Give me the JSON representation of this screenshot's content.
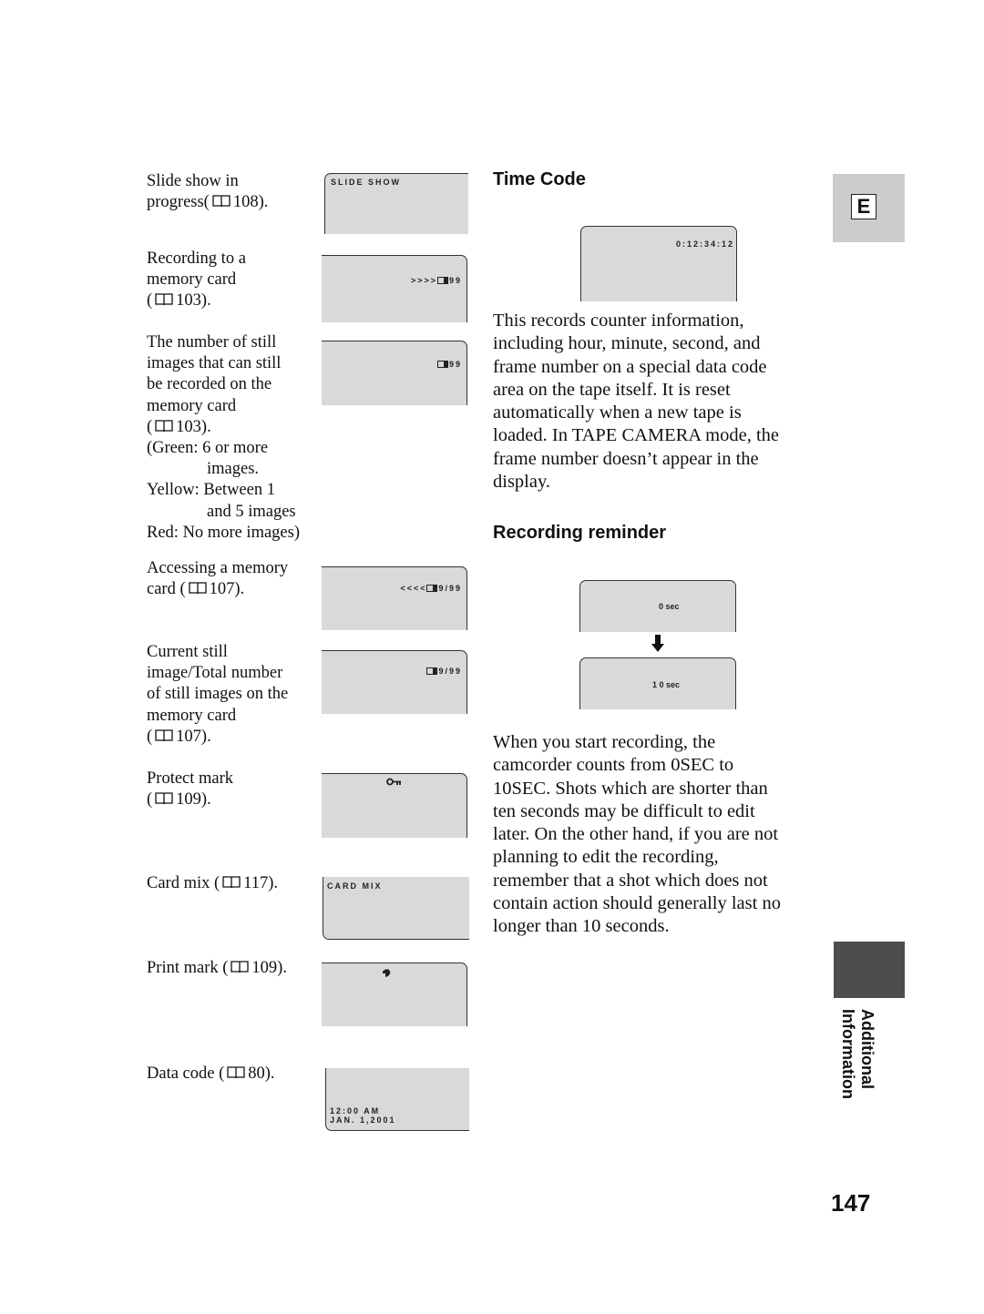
{
  "left_items": [
    {
      "lines": [
        "Slide show in",
        "progress( {book} 108)."
      ],
      "display": [
        "SLIDE SHOW"
      ]
    },
    {
      "lines": [
        "Recording to a",
        "memory card",
        "( {book} 103)."
      ],
      "display": [
        ">>>>{card}99"
      ]
    },
    {
      "lines": [
        "The number of still",
        "images that can still",
        "be recorded on the",
        "memory card",
        "( {book} 103).",
        "(Green: 6 or more",
        "images.",
        "Yellow: Between 1",
        "and 5 images",
        "Red: No more images)"
      ],
      "display": [
        "{card}99"
      ]
    },
    {
      "lines": [
        "Accessing a memory",
        "card ( {book} 107)."
      ],
      "display": [
        "<<<<{card}9/99"
      ]
    },
    {
      "lines": [
        "Current still",
        "image/Total number",
        "of still images on the",
        "memory card",
        "( {book} 107)."
      ],
      "display": [
        "{card}9/99"
      ]
    },
    {
      "lines": [
        "Protect mark",
        "( {book} 109)."
      ],
      "display": [
        "key-icon"
      ]
    },
    {
      "lines": [
        "Card mix ( {book} 117)."
      ],
      "display": [
        "CARD MIX"
      ]
    },
    {
      "lines": [
        "Print mark ( {book} 109)."
      ],
      "display": [
        "print-mark-icon"
      ]
    },
    {
      "lines": [
        "Data code ( {book} 80)."
      ],
      "display": [
        "12:00 AM",
        "JAN. 1,2001"
      ]
    }
  ],
  "sections": [
    {
      "heading": "Time Code",
      "display": "0:12:34:12",
      "body": [
        "This records counter information,",
        "including hour, minute, second, and",
        "frame number on a special data code",
        "area on the tape itself. It is reset",
        "automatically when a new tape is",
        "loaded. In TAPE CAMERA mode, the",
        "frame number doesn’t appear in the",
        "display."
      ]
    },
    {
      "heading": "Recording reminder",
      "display_before": "0 sec",
      "display_after": "1 0 sec",
      "body": [
        "When you start recording, the",
        "camcorder counts from 0SEC to",
        "10SEC. Shots which are shorter than",
        "ten seconds may be difficult to edit",
        "later. On the other hand, if you are not",
        "planning to edit the recording,",
        "remember that a shot which does not",
        "contain action should generally last no",
        "longer than 10 seconds."
      ]
    }
  ],
  "side_tabs": {
    "language": "E",
    "section": [
      "Additional",
      "Information"
    ]
  },
  "page_number": "147",
  "colors": {
    "lcd_bg": "#d9d9d9",
    "tab_light": "#cccccc",
    "tab_dark": "#4d4d4d"
  }
}
